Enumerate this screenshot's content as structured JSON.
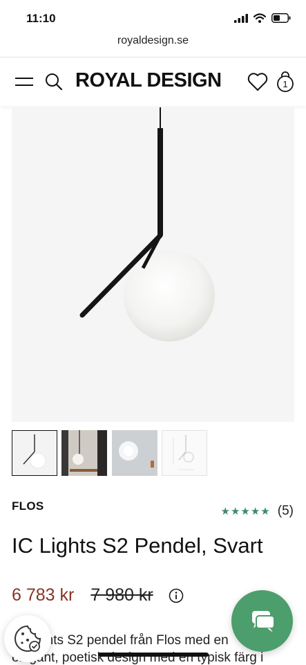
{
  "status_bar": {
    "time": "11:10"
  },
  "browser": {
    "url": "royaldesign.se"
  },
  "header": {
    "logo": "ROYAL DESIGN"
  },
  "product": {
    "brand": "FLOS",
    "rating_count": "(5)",
    "rating_stars": 5,
    "title": "IC Lights S2 Pendel, Svart",
    "price_current": "6 783 kr",
    "price_old": "7 980 kr",
    "description_line1": "IC Lights S2 pendel från Flos med en",
    "description_line2": "elegant, poetisk design med en typisk färg i"
  },
  "colors": {
    "accent_green": "#4c9e6c",
    "price_red": "#8a3326",
    "star_green": "#3c8a6a"
  },
  "icons": [
    "menu-icon",
    "search-icon",
    "heart-icon",
    "bag-icon",
    "info-icon",
    "cookie-icon",
    "chat-icon"
  ]
}
